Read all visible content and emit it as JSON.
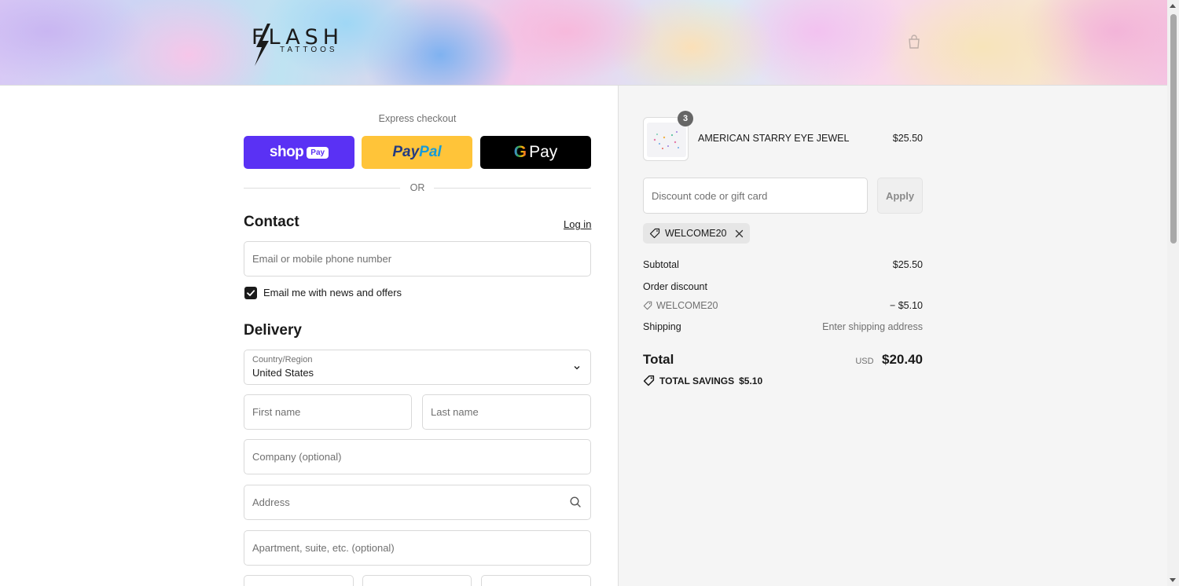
{
  "brand": {
    "name": "FLASH",
    "sub": "TATTOOS"
  },
  "express": {
    "title": "Express checkout",
    "shop_pay": {
      "text": "shop",
      "pill": "Pay"
    },
    "paypal": {
      "pay": "Pay",
      "pal": "Pal"
    },
    "gpay": {
      "g": "G",
      "text": "Pay"
    },
    "or": "OR"
  },
  "contact": {
    "title": "Contact",
    "login": "Log in",
    "email_placeholder": "Email or mobile phone number",
    "newsletter_label": "Email me with news and offers",
    "newsletter_checked": true
  },
  "delivery": {
    "title": "Delivery",
    "country_label": "Country/Region",
    "country_value": "United States",
    "first_name_placeholder": "First name",
    "last_name_placeholder": "Last name",
    "company_placeholder": "Company (optional)",
    "address_placeholder": "Address",
    "apartment_placeholder": "Apartment, suite, etc. (optional)"
  },
  "summary": {
    "product": {
      "name": "AMERICAN STARRY EYE JEWEL",
      "price": "$25.50",
      "quantity": "3"
    },
    "discount_placeholder": "Discount code or gift card",
    "apply_label": "Apply",
    "applied_code": "WELCOME20",
    "subtotal_label": "Subtotal",
    "subtotal_value": "$25.50",
    "order_discount_label": "Order discount",
    "discount_code": "WELCOME20",
    "discount_value": "− $5.10",
    "shipping_label": "Shipping",
    "shipping_value": "Enter shipping address",
    "total_label": "Total",
    "total_currency": "USD",
    "total_value": "$20.40",
    "savings_label": "TOTAL SAVINGS",
    "savings_value": "$5.10"
  },
  "colors": {
    "shop_pay": "#5a31f4",
    "paypal": "#ffc439",
    "gpay": "#000000",
    "summary_bg": "#f5f5f5"
  }
}
